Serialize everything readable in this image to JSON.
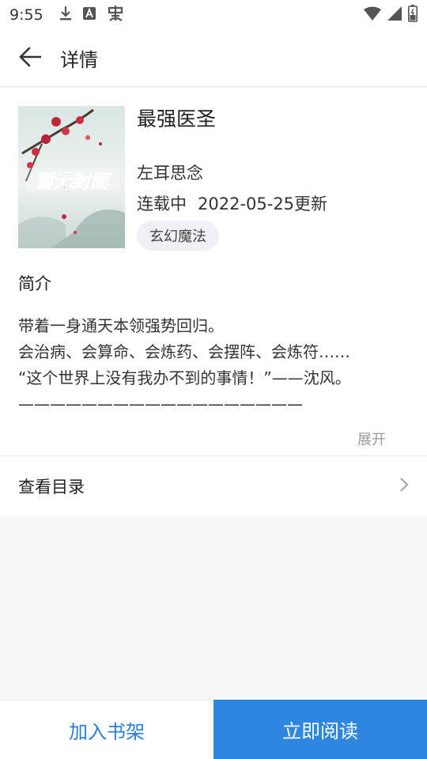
{
  "status_bar": {
    "time": "9:55",
    "icons_left": [
      "download-icon",
      "font-a-icon",
      "bug-icon"
    ],
    "icons_right": [
      "wifi-icon",
      "cell-signal-icon",
      "battery-icon"
    ]
  },
  "app_bar": {
    "title": "详情"
  },
  "book": {
    "cover_text": "暂无封面",
    "title": "最强医圣",
    "author": "左耳思念",
    "status": "连载中",
    "updated": "2022-05-25更新",
    "genre": "玄幻魔法"
  },
  "intro": {
    "heading": "简介",
    "lines": [
      "带着一身通天本领强势回归。",
      "会治病、会算命、会炼药、会摆阵、会炼符……",
      "“这个世界上没有我办不到的事情！”——沈风。",
      "——————————————————"
    ],
    "expand_label": "展开"
  },
  "toc": {
    "label": "查看目录"
  },
  "bottom_bar": {
    "add_shelf_label": "加入书架",
    "read_now_label": "立即阅读"
  },
  "colors": {
    "accent": "#2f86e0",
    "link_text": "#2b7fd8",
    "tag_bg": "#eef0f4",
    "page_bg": "#f7f7f7"
  }
}
